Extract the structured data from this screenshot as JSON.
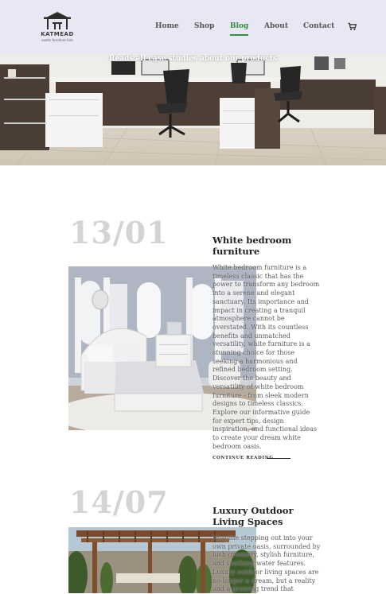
{
  "brand": {
    "name": "KATMEAD",
    "tagline": "exotic furniture hire"
  },
  "nav": {
    "items": [
      {
        "label": "Home",
        "active": false
      },
      {
        "label": "Shop",
        "active": false
      },
      {
        "label": "Blog",
        "active": true
      },
      {
        "label": "About",
        "active": false
      },
      {
        "label": "Contact",
        "active": false
      }
    ],
    "cart_icon": "cart-icon"
  },
  "hero": {
    "caption": "Reads all case studies about our products"
  },
  "posts": [
    {
      "date": "13/01",
      "title": "White bedroom furniture",
      "excerpt": "White bedroom furniture is a timeless classic that has the power to transform any bedroom into a serene and elegant sanctuary. Its importance and impact in creating a tranquil atmosphere cannot be overstated. With its countless benefits and unmatched versatility, white furniture is a stunning choice for those seeking a harmonious and refined bedroom setting. Discover the beauty and versatility of white bedroom furniture - from sleek modern designs to timeless classics. Explore our informative guide for expert tips, design inspiration, and functional ideas to create your dream white bedroom oasis.",
      "link": "CONTINUE READING"
    },
    {
      "date": "14/07",
      "title": "Luxury Outdoor Living Spaces",
      "excerpt": "Imagine stepping out into your own private oasis, surrounded by lush greenery, stylish furniture, and soothing water features. Luxury outdoor living spaces are no longer a dream, but a reality and a growing trend that"
    }
  ],
  "colors": {
    "header_bg": "#e7e8f4",
    "accent": "#2f8f3f",
    "date": "#d4d4d4"
  }
}
